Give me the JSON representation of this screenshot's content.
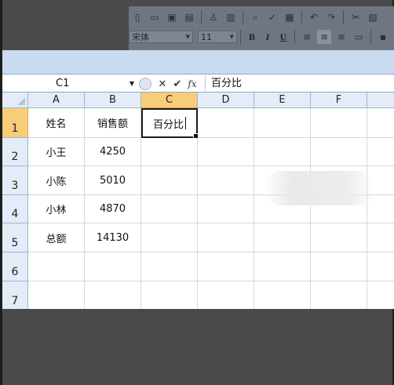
{
  "toolbar": {
    "font_name": "宋体",
    "font_size": "11",
    "bold_label": "B",
    "italic_label": "I",
    "underline_label": "U"
  },
  "formula_bar": {
    "name_box": "C1",
    "content": "百分比",
    "fx_label": "fx"
  },
  "columns": [
    "A",
    "B",
    "C",
    "D",
    "E",
    "F"
  ],
  "selected_column": "C",
  "rows": [
    "1",
    "2",
    "3",
    "4",
    "5",
    "6",
    "7"
  ],
  "selected_row": "1",
  "cells": {
    "A1": "姓名",
    "B1": "销售额",
    "C1": "百分比",
    "A2": "小王",
    "B2": "4250",
    "A3": "小陈",
    "B3": "5010",
    "A4": "小林",
    "B4": "4870",
    "A5": "总额",
    "B5": "14130"
  },
  "active_cell": "C1",
  "colors": {
    "header_bg": "#e4ecf7",
    "selected_header_bg": "#f8cd78",
    "gridline": "#d0d7e5",
    "ribbon_bg": "#c9dbf0"
  }
}
